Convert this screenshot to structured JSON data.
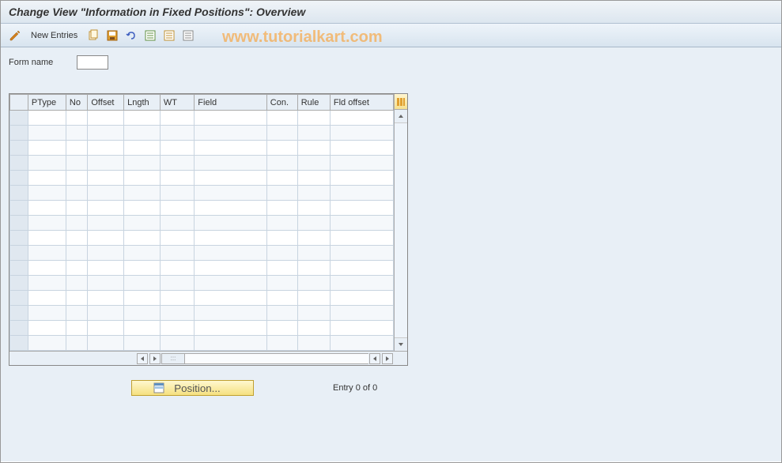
{
  "title": "Change View \"Information in Fixed Positions\": Overview",
  "toolbar": {
    "new_entries": "New Entries"
  },
  "watermark": "www.tutorialkart.com",
  "form": {
    "form_name_label": "Form name",
    "form_name_value": ""
  },
  "table": {
    "columns": [
      "PType",
      "No",
      "Offset",
      "Lngth",
      "WT",
      "Field",
      "Con.",
      "Rule",
      "Fld offset"
    ],
    "rows": 16
  },
  "footer": {
    "position_label": "Position...",
    "entry_status": "Entry 0 of 0"
  }
}
